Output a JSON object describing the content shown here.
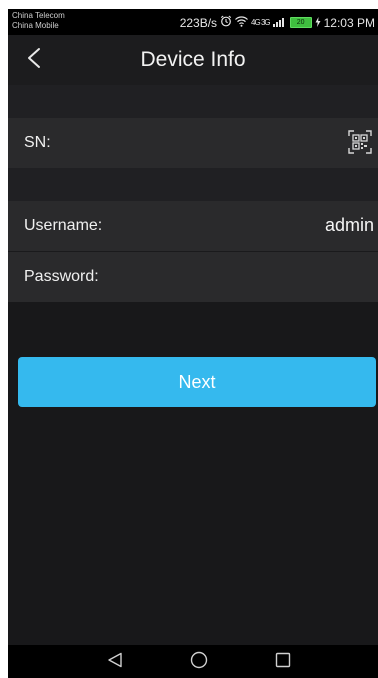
{
  "status_bar": {
    "carrier_1": "China Telecom",
    "carrier_2": "China Mobile",
    "net_speed": "223B/s",
    "signal_text": "4G 3G",
    "battery": "20",
    "time": "12:03 PM"
  },
  "app_bar": {
    "title": "Device Info",
    "back_icon": "chevron-left-icon"
  },
  "form": {
    "sn": {
      "label": "SN:",
      "value": "",
      "icon": "qr-scan-icon"
    },
    "username": {
      "label": "Username:",
      "value": "admin"
    },
    "password": {
      "label": "Password:",
      "value": ""
    }
  },
  "next_button": {
    "label": "Next"
  },
  "nav_bar": {
    "back_icon": "nav-back-icon",
    "home_icon": "nav-home-icon",
    "recents_icon": "nav-recents-icon"
  },
  "colors": {
    "accent": "#35b9ee",
    "background": "#18181a",
    "row": "#2a2a2c"
  }
}
